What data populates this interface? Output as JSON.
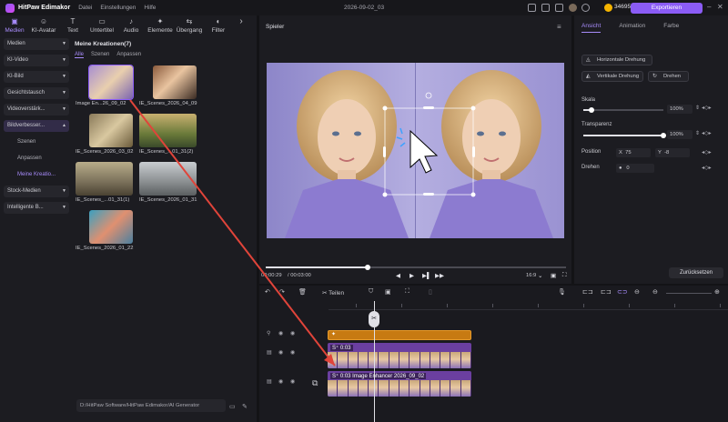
{
  "titlebar": {
    "app_name": "HitPaw Edimakor",
    "menu": [
      "Datei",
      "Einstellungen",
      "Hilfe"
    ],
    "project_name": "2026-09-02_03",
    "credits": "34695",
    "export_label": "Exportieren",
    "plus": "+"
  },
  "toptabs": [
    {
      "label": "Medien",
      "icon": "▣"
    },
    {
      "label": "KI-Avatar",
      "icon": "☺"
    },
    {
      "label": "Text",
      "icon": "T"
    },
    {
      "label": "Untertitel",
      "icon": "▭"
    },
    {
      "label": "Audio",
      "icon": "♪"
    },
    {
      "label": "Elemente",
      "icon": "✦"
    },
    {
      "label": "Übergang",
      "icon": "⇆"
    },
    {
      "label": "Filter",
      "icon": "◐"
    }
  ],
  "sidenav": {
    "items": [
      "Medien",
      "KI-Video",
      "KI-Bild",
      "Gesichtstausch",
      "Videoverstärk...",
      "Bildverbesser..."
    ],
    "subitems": [
      "Szenen",
      "Anpassen",
      "Meine Kreatio..."
    ],
    "bottom_items": [
      "Stock-Medien",
      "Intelligente B..."
    ]
  },
  "media": {
    "header": "Meine Kreationen(7)",
    "filters": [
      "Alle",
      "Szenen",
      "Anpassen"
    ],
    "items": [
      {
        "label": "Image En...26_09_02"
      },
      {
        "label": "IE_Scenes_2026_04_09"
      },
      {
        "label": "IE_Scenes_2026_03_02"
      },
      {
        "label": "IE_Scenes_...01_31(2)"
      },
      {
        "label": "IE_Scenes_...01_31(1)"
      },
      {
        "label": "IE_Scenes_2026_01_31"
      },
      {
        "label": "IE_Scenes_2026_01_22"
      }
    ],
    "path": "D:/HitPaw Software/HitPaw Edimakor/AI Generator"
  },
  "player": {
    "title": "Spieler",
    "current_time": "00:00:29",
    "total_time": "/ 00:03:00",
    "aspect": "16:9",
    "progress": 0.34
  },
  "props": {
    "tabs": [
      "Ansicht",
      "Animation",
      "Farbe"
    ],
    "flip_h": "Horizontale Drehung",
    "flip_v": "Vertikale Drehung",
    "rotate": "Drehen",
    "scale_label": "Skala",
    "scale_value": "100%",
    "scale_level": 0.1,
    "opacity_label": "Transparenz",
    "opacity_value": "100%",
    "opacity_level": 1.0,
    "position_label": "Position",
    "pos_x_label": "X",
    "pos_x": "75",
    "pos_y_label": "Y",
    "pos_y": "-8",
    "rotate_label": "Drehen",
    "rotate_value": "0",
    "reset_label": "Zurücksetzen"
  },
  "timeline": {
    "split_label": "Teilen",
    "effect_clip_label": "✦",
    "clip1_label": "S⁺ 0:03",
    "clip2_label": "S⁺ 0:03 Image Enhancer 2026_09_02"
  }
}
